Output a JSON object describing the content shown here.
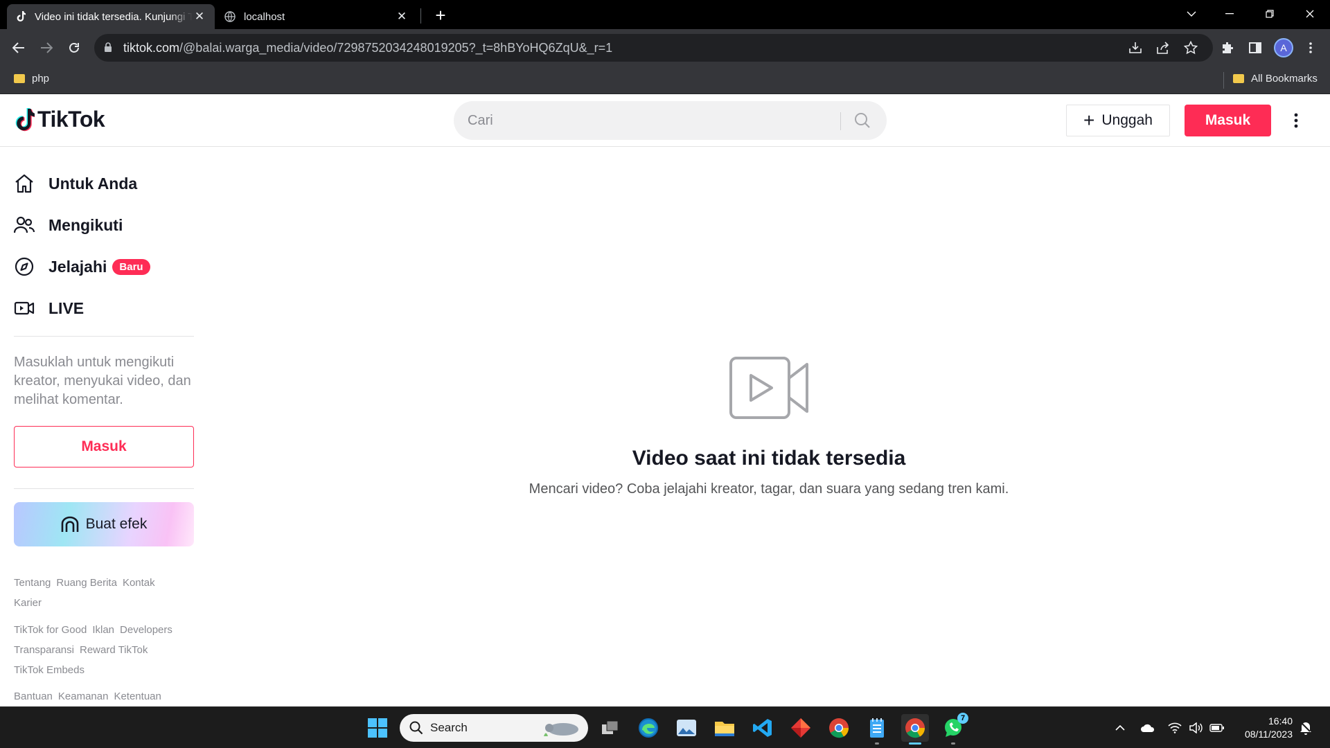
{
  "browser": {
    "tabs": [
      {
        "title": "Video ini tidak tersedia. Kunjungi TikTok",
        "icon": "tiktok-icon",
        "active": true
      },
      {
        "title": "localhost",
        "icon": "globe-icon",
        "active": false
      }
    ],
    "url_domain": "tiktok.com",
    "url_path": "/@balai.warga_media/video/7298752034248019205?_t=8hBYoHQ6ZqU&_r=1",
    "profile_initial": "A",
    "bookmarks": [
      {
        "label": "php",
        "icon": "folder-icon"
      }
    ],
    "all_bookmarks_label": "All Bookmarks"
  },
  "tiktok": {
    "logo_text": "TikTok",
    "search_placeholder": "Cari",
    "upload_label": "Unggah",
    "login_label": "Masuk",
    "nav": [
      {
        "label": "Untuk Anda",
        "icon": "home-icon"
      },
      {
        "label": "Mengikuti",
        "icon": "following-icon"
      },
      {
        "label": "Jelajahi",
        "icon": "compass-icon",
        "badge": "Baru"
      },
      {
        "label": "LIVE",
        "icon": "live-icon"
      }
    ],
    "login_hint": "Masuklah untuk mengikuti kreator, menyukai video, dan melihat komentar.",
    "sidebar_login_label": "Masuk",
    "effect_label": "Buat efek",
    "footer_groups": [
      [
        "Tentang",
        "Ruang Berita",
        "Kontak",
        "Karier"
      ],
      [
        "TikTok for Good",
        "Iklan",
        "Developers",
        "Transparansi",
        "Reward TikTok",
        "TikTok Embeds"
      ],
      [
        "Bantuan",
        "Keamanan",
        "Ketentuan"
      ]
    ],
    "empty_title": "Video saat ini tidak tersedia",
    "empty_subtitle": "Mencari video? Coba jelajahi kreator, tagar, dan suara yang sedang tren kami."
  },
  "taskbar": {
    "search_label": "Search",
    "time": "16:40",
    "date": "08/11/2023",
    "whatsapp_badge": "7",
    "accent": "#60cdff"
  },
  "colors": {
    "brand": "#fe2c55",
    "text": "#161823",
    "muted": "#8a8b91"
  }
}
